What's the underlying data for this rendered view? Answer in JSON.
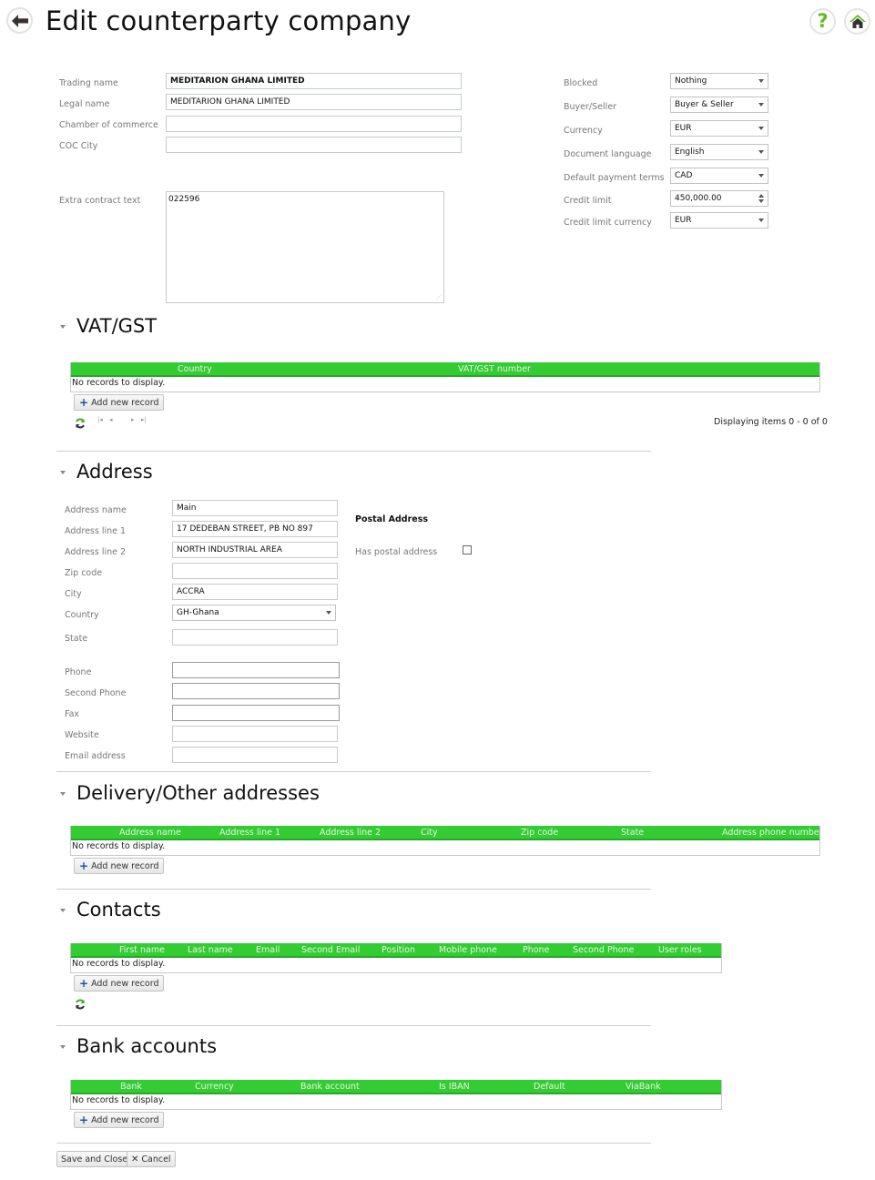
{
  "header": {
    "title": "Edit counterparty company",
    "back_icon": "arrow-left-icon",
    "help_icon": "question-icon",
    "home_icon": "home-icon"
  },
  "company": {
    "trading_name": {
      "label": "Trading name",
      "value": "MEDITARION GHANA LIMITED"
    },
    "legal_name": {
      "label": "Legal name",
      "value": "MEDITARION GHANA LIMITED"
    },
    "chamber_of_commerce": {
      "label": "Chamber of commerce",
      "value": ""
    },
    "coc_city": {
      "label": "COC City",
      "value": ""
    },
    "extra_contract_text": {
      "label": "Extra contract text",
      "value": "022596"
    }
  },
  "settings": {
    "blocked": {
      "label": "Blocked",
      "value": "Nothing"
    },
    "buyer_seller": {
      "label": "Buyer/Seller",
      "value": "Buyer & Seller"
    },
    "currency": {
      "label": "Currency",
      "value": "EUR"
    },
    "document_language": {
      "label": "Document language",
      "value": "English"
    },
    "default_payment_terms": {
      "label": "Default payment terms",
      "value": "CAD"
    },
    "credit_limit": {
      "label": "Credit limit",
      "value": "450,000.00"
    },
    "credit_limit_currency": {
      "label": "Credit limit currency",
      "value": "EUR"
    }
  },
  "vat": {
    "title": "VAT/GST",
    "columns": [
      "Country",
      "VAT/GST number"
    ],
    "empty_text": "No records to display.",
    "add_label": "Add new record",
    "pager_info": "Displaying items 0 - 0 of 0",
    "pager_first": "⏮",
    "pager_prev": "◀",
    "pager_next": "▶",
    "pager_last": "⏭"
  },
  "address": {
    "title": "Address",
    "address_name": {
      "label": "Address name",
      "value": "Main"
    },
    "address_line1": {
      "label": "Address line 1",
      "value": "17 DEDEBAN STREET, PB NO 897"
    },
    "address_line2": {
      "label": "Address line 2",
      "value": "NORTH INDUSTRIAL AREA"
    },
    "zip_code": {
      "label": "Zip code",
      "value": ""
    },
    "city": {
      "label": "City",
      "value": "ACCRA"
    },
    "country": {
      "label": "Country",
      "value": "GH-Ghana"
    },
    "state": {
      "label": "State",
      "value": ""
    },
    "phone": {
      "label": "Phone",
      "value": ""
    },
    "second_phone": {
      "label": "Second Phone",
      "value": ""
    },
    "fax": {
      "label": "Fax",
      "value": ""
    },
    "website": {
      "label": "Website",
      "value": ""
    },
    "email": {
      "label": "Email address",
      "value": ""
    },
    "postal_heading": "Postal Address",
    "has_postal_label": "Has postal address",
    "has_postal_checked": false
  },
  "delivery": {
    "title": "Delivery/Other addresses",
    "columns": [
      "Address name",
      "Address line 1",
      "Address line 2",
      "City",
      "Zip code",
      "State",
      "Address phone number"
    ],
    "empty_text": "No records to display.",
    "add_label": "Add new record"
  },
  "contacts": {
    "title": "Contacts",
    "columns": [
      "First name",
      "Last name",
      "Email",
      "Second Email",
      "Position",
      "Mobile phone",
      "Phone",
      "Second Phone",
      "User roles"
    ],
    "empty_text": "No records to display.",
    "add_label": "Add new record"
  },
  "bank": {
    "title": "Bank accounts",
    "columns": [
      "Bank",
      "Currency",
      "Bank account",
      "Is IBAN",
      "Default",
      "ViaBank"
    ],
    "empty_text": "No records to display.",
    "add_label": "Add new record"
  },
  "footer": {
    "save_label": "Save and Close",
    "cancel_label": "Cancel"
  },
  "colors": {
    "grid_header": "#33cc33",
    "accent_green": "#5cbf2a"
  }
}
